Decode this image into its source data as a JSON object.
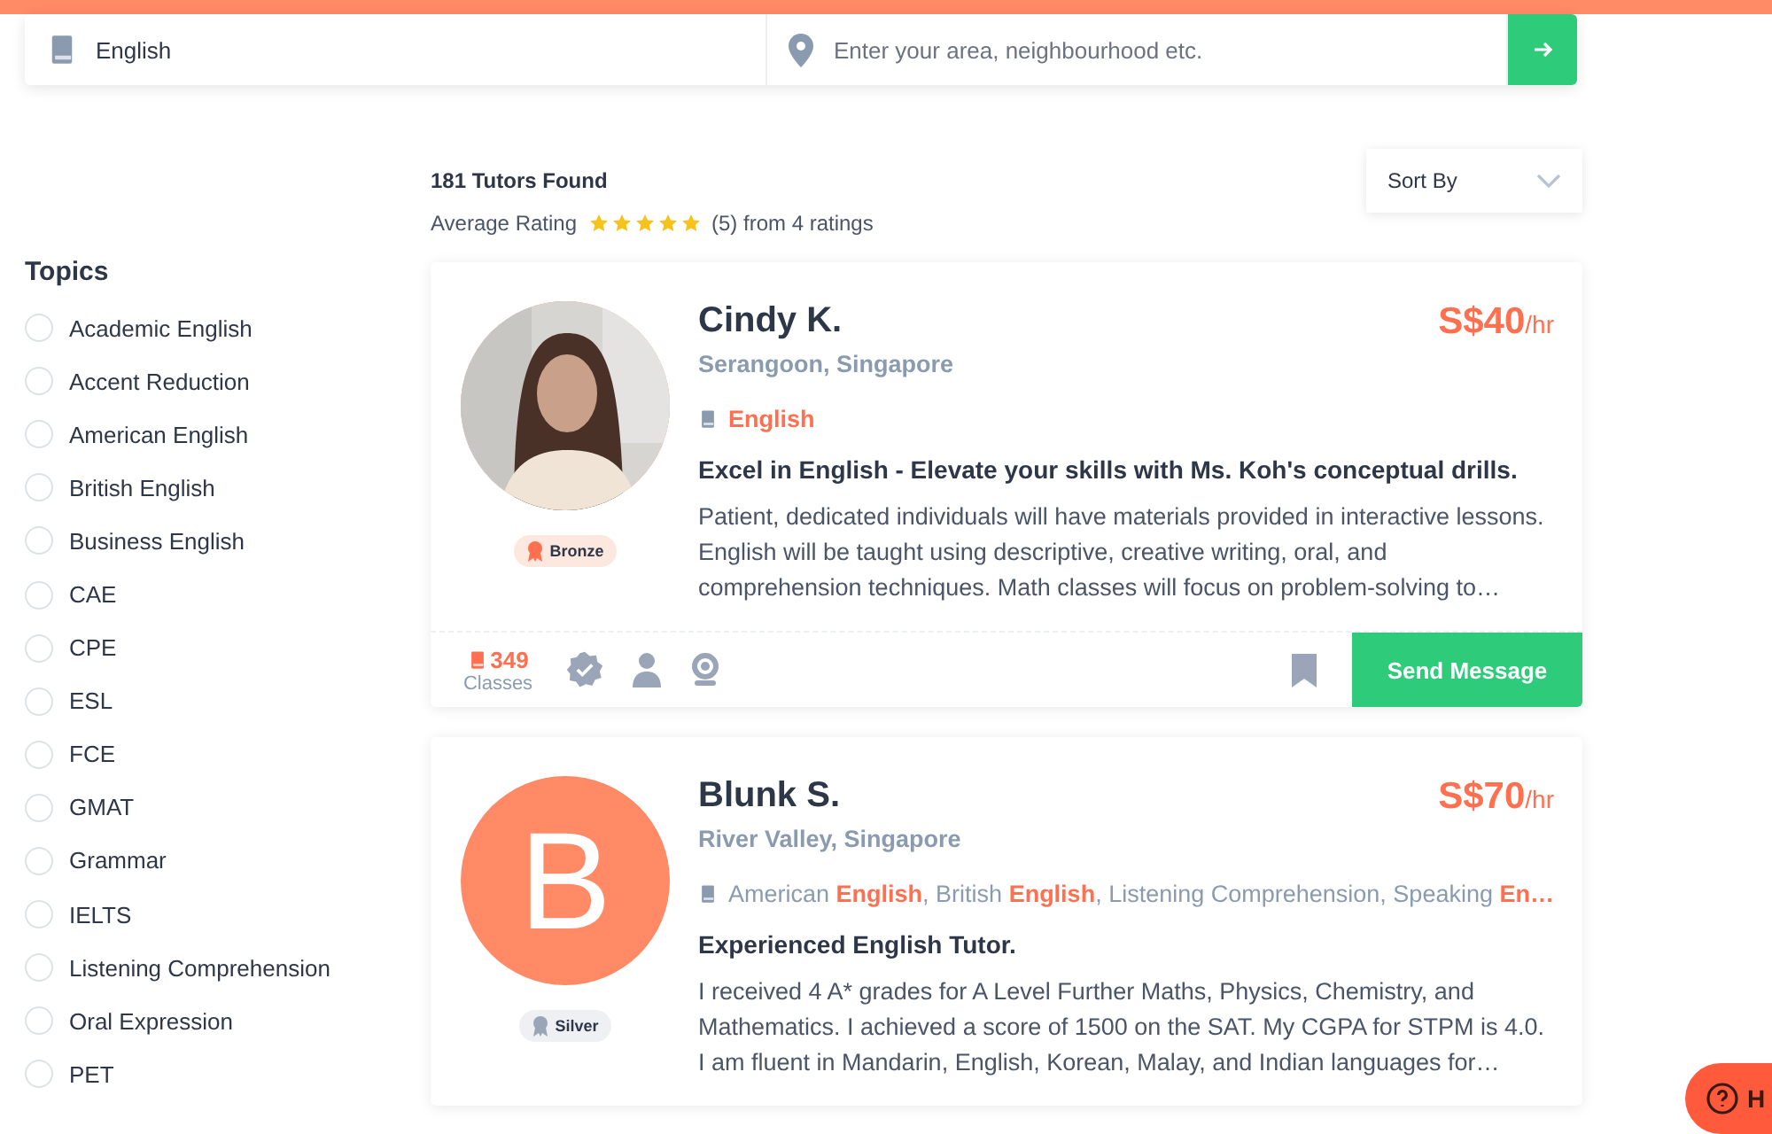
{
  "search": {
    "subject": "English",
    "location_placeholder": "Enter your area, neighbourhood etc."
  },
  "results": {
    "count": "181 Tutors Found",
    "rating_label": "Average Rating",
    "stars": 5,
    "rating_text": "(5) from 4 ratings",
    "sort": "Sort By"
  },
  "topics": {
    "title": "Topics",
    "items": [
      {
        "label": "Academic English",
        "selected": false
      },
      {
        "label": "Accent Reduction",
        "selected": false
      },
      {
        "label": "American English",
        "selected": false
      },
      {
        "label": "British English",
        "selected": false
      },
      {
        "label": "Business English",
        "selected": false
      },
      {
        "label": "CAE",
        "selected": false
      },
      {
        "label": "CPE",
        "selected": false
      },
      {
        "label": "ESL",
        "selected": false
      },
      {
        "label": "FCE",
        "selected": false
      },
      {
        "label": "GMAT",
        "selected": false
      },
      {
        "label": "Grammar",
        "selected": false
      },
      {
        "label": "IELTS",
        "selected": false
      },
      {
        "label": "Listening Comprehension",
        "selected": false
      },
      {
        "label": "Oral Expression",
        "selected": false
      },
      {
        "label": "PET",
        "selected": false
      }
    ]
  },
  "tutors": [
    {
      "tier": "Bronze",
      "name": "Cindy K.",
      "location": "Serangoon, Singapore",
      "price": "S$40",
      "unit": "/hr",
      "subjects": "**English**",
      "headline": "Excel in English - Elevate your skills with Ms. Koh's conceptual drills.",
      "description": "Patient, dedicated individuals will have materials provided in interactive lessons. English will be taught using descriptive, creative writing, oral, and comprehension techniques. Math classes will focus on problem-solving to…",
      "classes": "349",
      "classes_label": "Classes",
      "action": "Send Message"
    },
    {
      "avatar": {
        "kind": "initial",
        "letter": "B"
      },
      "tier": "Silver",
      "name": "Blunk S.",
      "location": "River Valley, Singapore",
      "price": "S$70",
      "unit": "/hr",
      "subjects": "American **English**, British **English**, Listening Comprehension, Speaking **En…**",
      "headline": "Experienced English Tutor.",
      "description": "I received 4 A* grades for A Level Further Maths, Physics, Chemistry, and Mathematics. I achieved a score of 1500 on the SAT. My CGPA for STPM is 4.0. I am fluent in Mandarin, English, Korean, Malay, and Indian languages for…"
    }
  ],
  "help": {
    "label": "H"
  }
}
